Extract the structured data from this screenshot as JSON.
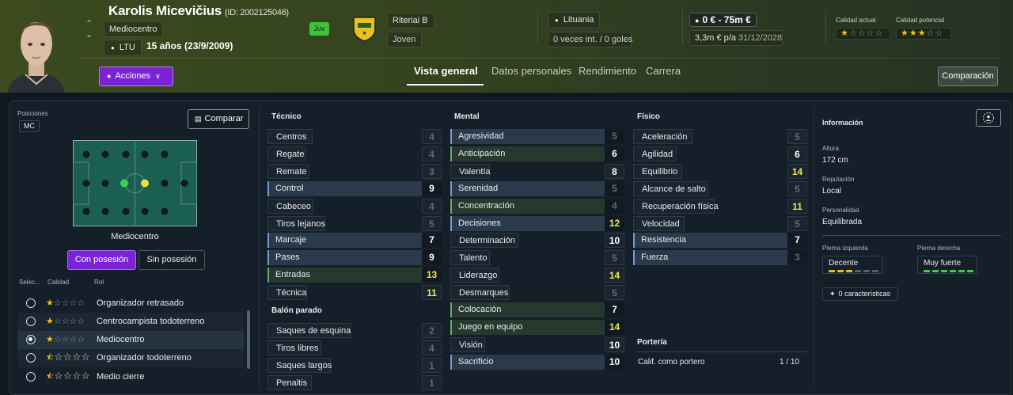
{
  "player": {
    "name": "Karolis Micevičius",
    "id_text": "(ID: 2002125046)",
    "position": "Mediocentro",
    "nation": "LTU",
    "age_text": "15 años (23/9/2009)",
    "squad_tag": "Juv"
  },
  "club": {
    "team": "Riteriai B",
    "status": "Joven",
    "country": "Lituania",
    "intl": "0 veces int. / 0 goles"
  },
  "value": {
    "range": "0 € - 75m €",
    "wage": "3,3m € p/a",
    "contract_end": "31/12/2028"
  },
  "quality": {
    "current_label": "Calidad actual",
    "current_stars": 1,
    "potential_label": "Calidad potencial",
    "potential_stars": 3
  },
  "actions_label": "Acciones",
  "tabs": [
    {
      "label": "Vista general",
      "active": true
    },
    {
      "label": "Datos personales",
      "active": false
    },
    {
      "label": "Rendimiento",
      "active": false
    },
    {
      "label": "Carrera",
      "active": false
    }
  ],
  "compare_top_label": "Comparación",
  "left": {
    "positions_label": "Posiciones",
    "position_code": "MC",
    "compare_label": "Comparar",
    "pitch_label": "Mediocentro",
    "toggle_on": "Con posesión",
    "toggle_off": "Sin posesión",
    "headers": {
      "select": "Selec...",
      "quality": "Calidad",
      "role": "Rol"
    },
    "roles": [
      {
        "name": "Organizador retrasado",
        "stars": 1,
        "selected": false
      },
      {
        "name": "Centrocampista todoterreno",
        "stars": 1,
        "selected": false
      },
      {
        "name": "Mediocentro",
        "stars": 1,
        "selected": true
      },
      {
        "name": "Organizador todoterreno",
        "stars": 0.5,
        "selected": false
      },
      {
        "name": "Medio cierre",
        "stars": 0.5,
        "selected": false
      }
    ]
  },
  "tecnico": {
    "title": "Técnico",
    "items": [
      {
        "name": "Centros",
        "value": "4",
        "style": "plain",
        "color": "dim"
      },
      {
        "name": "Regate",
        "value": "4",
        "style": "plain",
        "color": "dim"
      },
      {
        "name": "Remate",
        "value": "3",
        "style": "plain",
        "color": "dim"
      },
      {
        "name": "Control",
        "value": "9",
        "style": "blue",
        "color": "wht"
      },
      {
        "name": "Cabeceo",
        "value": "4",
        "style": "plain",
        "color": "dim"
      },
      {
        "name": "Tiros lejanos",
        "value": "5",
        "style": "plain",
        "color": "dim"
      },
      {
        "name": "Marcaje",
        "value": "7",
        "style": "blue",
        "color": "wht"
      },
      {
        "name": "Pases",
        "value": "9",
        "style": "blue",
        "color": "wht"
      },
      {
        "name": "Entradas",
        "value": "13",
        "style": "green",
        "color": "yel"
      },
      {
        "name": "Técnica",
        "value": "11",
        "style": "plain",
        "color": "yel"
      }
    ]
  },
  "balon_parado": {
    "title": "Balón parado",
    "items": [
      {
        "name": "Saques de esquina",
        "value": "2",
        "style": "plain",
        "color": "dim"
      },
      {
        "name": "Tiros libres",
        "value": "4",
        "style": "plain",
        "color": "dim"
      },
      {
        "name": "Saques largos",
        "value": "1",
        "style": "plain",
        "color": "dim"
      },
      {
        "name": "Penaltis",
        "value": "1",
        "style": "plain",
        "color": "dim"
      }
    ]
  },
  "mental": {
    "title": "Mental",
    "items": [
      {
        "name": "Agresividad",
        "value": "5",
        "style": "blue",
        "color": "dim"
      },
      {
        "name": "Anticipación",
        "value": "6",
        "style": "green",
        "color": "wht"
      },
      {
        "name": "Valentía",
        "value": "8",
        "style": "plain",
        "color": "wht"
      },
      {
        "name": "Serenidad",
        "value": "5",
        "style": "blue",
        "color": "dim"
      },
      {
        "name": "Concentración",
        "value": "4",
        "style": "green",
        "color": "dim"
      },
      {
        "name": "Decisiones",
        "value": "12",
        "style": "blue",
        "color": "yel"
      },
      {
        "name": "Determinación",
        "value": "10",
        "style": "plain",
        "color": "wht"
      },
      {
        "name": "Talento",
        "value": "5",
        "style": "plain",
        "color": "dim"
      },
      {
        "name": "Liderazgo",
        "value": "14",
        "style": "plain",
        "color": "yel"
      },
      {
        "name": "Desmarques",
        "value": "5",
        "style": "plain",
        "color": "dim"
      },
      {
        "name": "Colocación",
        "value": "7",
        "style": "green",
        "color": "wht"
      },
      {
        "name": "Juego en equipo",
        "value": "14",
        "style": "green",
        "color": "yel"
      },
      {
        "name": "Visión",
        "value": "10",
        "style": "plain",
        "color": "wht"
      },
      {
        "name": "Sacrificio",
        "value": "10",
        "style": "blue",
        "color": "wht"
      }
    ]
  },
  "fisico": {
    "title": "Físico",
    "items": [
      {
        "name": "Aceleración",
        "value": "5",
        "style": "plain",
        "color": "dim"
      },
      {
        "name": "Agilidad",
        "value": "6",
        "style": "plain",
        "color": "wht"
      },
      {
        "name": "Equilibrio",
        "value": "14",
        "style": "plain",
        "color": "yel"
      },
      {
        "name": "Alcance de salto",
        "value": "5",
        "style": "plain",
        "color": "dim"
      },
      {
        "name": "Recuperación física",
        "value": "11",
        "style": "plain",
        "color": "yel"
      },
      {
        "name": "Velocidad",
        "value": "5",
        "style": "plain",
        "color": "dim"
      },
      {
        "name": "Resistencia",
        "value": "7",
        "style": "blue",
        "color": "wht"
      },
      {
        "name": "Fuerza",
        "value": "3",
        "style": "blue",
        "color": "dim"
      }
    ]
  },
  "porteria": {
    "title": "Portería",
    "label": "Calif. como portero",
    "value": "1 / 10"
  },
  "info": {
    "title": "Información",
    "height_label": "Altura",
    "height": "172 cm",
    "reputation_label": "Reputación",
    "reputation": "Local",
    "personality_label": "Personalidad",
    "personality": "Equilibrada",
    "left_foot_label": "Pierna izquierda",
    "left_foot": "Decente",
    "right_foot_label": "Pierna derecha",
    "right_foot": "Muy fuerte",
    "characteristics": "0 características"
  },
  "colors": {
    "accent": "#7a22d6",
    "star": "#f1c21b",
    "good": "#e9e84b",
    "green_badge": "#3ec335"
  }
}
